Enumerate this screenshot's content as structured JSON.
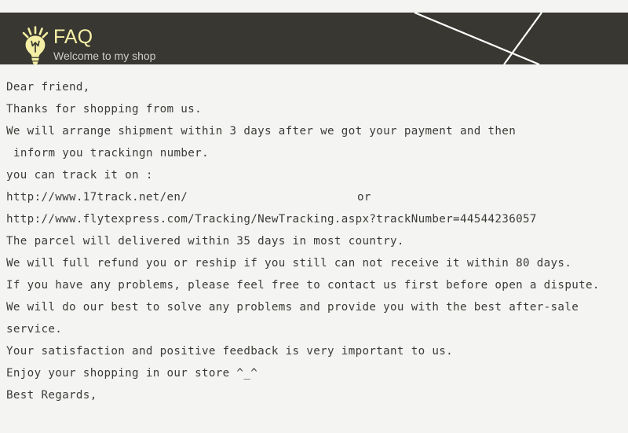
{
  "header": {
    "title": "FAQ",
    "subtitle": "Welcome to my shop",
    "icon": "lightbulb-icon",
    "background_color": "#383731",
    "title_color": "#f6f1a8",
    "subtitle_color": "#cfcfcb",
    "decor": "diagonal-line-graphic"
  },
  "page": {
    "background_color": "#f4f4f2",
    "text_color": "#3b3b38"
  },
  "body": {
    "lines": [
      {
        "id": "greeting",
        "text": "Dear friend,"
      },
      {
        "id": "thanks",
        "text": "Thanks for shopping from us."
      },
      {
        "id": "shipment-time",
        "text": "We will arrange shipment within 3 days after we got your payment and then"
      },
      {
        "id": "inform-tracking",
        "text": "inform you trackingn number.",
        "indent": true
      },
      {
        "id": "track-intro",
        "text": "you can track it on :"
      },
      {
        "id": "track-url-1",
        "text": "http://www.17track.net/en/",
        "trailing": "or"
      },
      {
        "id": "track-url-2",
        "text": "http://www.flytexpress.com/Tracking/NewTracking.aspx?trackNumber=44544236057"
      },
      {
        "id": "delivery-time",
        "text": "The parcel will delivered within 35 days in most country."
      },
      {
        "id": "refund-policy",
        "text": "We will full refund you or reship if you still can not receive it within 80 days."
      },
      {
        "id": "dispute-note",
        "text": "If you have any problems, please feel free to contact us first before open a dispute."
      },
      {
        "id": "service-promise",
        "text": "We will do our best to solve any problems and provide you with the best after-sale"
      },
      {
        "id": "service-promise-cont",
        "text": "service."
      },
      {
        "id": "feedback-note",
        "text": "Your satisfaction and positive feedback is very important to us."
      },
      {
        "id": "enjoy-note",
        "text": "Enjoy your shopping in our store ^_^"
      },
      {
        "id": "signoff",
        "text": "Best Regards,"
      }
    ]
  }
}
